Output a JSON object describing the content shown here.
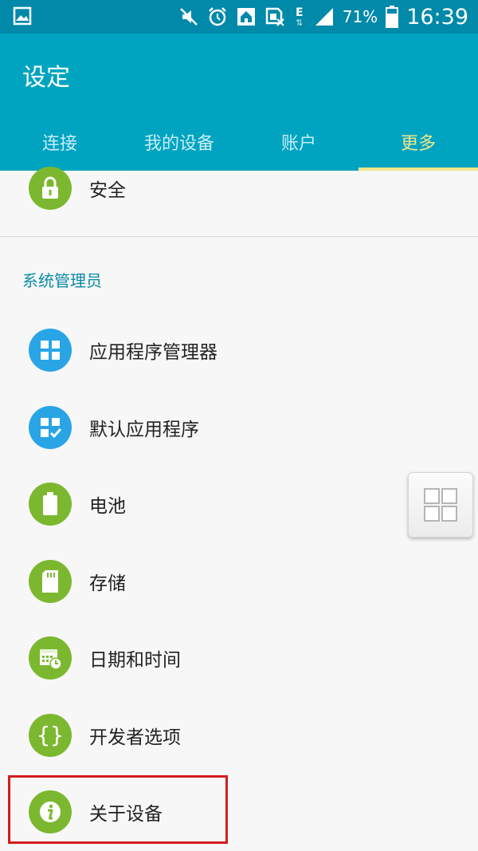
{
  "status_bar": {
    "battery_percent": "71%",
    "time": "16:39",
    "network": "E",
    "icons": [
      "gallery-icon",
      "mute-icon",
      "alarm-icon",
      "home-icon",
      "sim-icon",
      "network-icon",
      "signal-icon",
      "battery-icon"
    ]
  },
  "app_bar": {
    "title": "设定",
    "tabs": [
      {
        "label": "连接"
      },
      {
        "label": "我的设备"
      },
      {
        "label": "账户"
      },
      {
        "label": "更多"
      }
    ],
    "active_tab": "更多"
  },
  "list": {
    "top_item": {
      "label": "安全",
      "icon": "lock-icon"
    },
    "section_header": "系统管理员",
    "items": [
      {
        "label": "应用程序管理器",
        "icon": "app-grid-icon"
      },
      {
        "label": "默认应用程序",
        "icon": "default-apps-icon"
      },
      {
        "label": "电池",
        "icon": "battery-icon"
      },
      {
        "label": "存储",
        "icon": "sd-card-icon"
      },
      {
        "label": "日期和时间",
        "icon": "calendar-clock-icon"
      },
      {
        "label": "开发者选项",
        "icon": "braces-icon"
      },
      {
        "label": "关于设备",
        "icon": "info-icon"
      }
    ]
  },
  "colors": {
    "status_bar": "#0089a8",
    "app_bar": "#00a4c1",
    "active_tab": "#f0e68c",
    "green_icon": "#7cb82f",
    "blue_icon": "#29a5e6",
    "section_header": "#0a8aa6",
    "highlight": "#d21d1d"
  }
}
